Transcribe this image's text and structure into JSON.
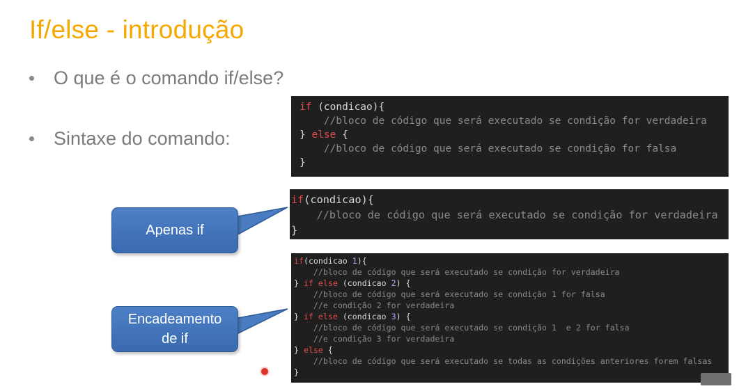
{
  "slide": {
    "title": "If/else - introdução",
    "bullets": [
      "O que é o comando if/else?",
      "Sintaxe do comando:"
    ]
  },
  "callouts": {
    "apenas_if": "Apenas if",
    "encadeamento": "Encadeamento de if"
  },
  "code_blocks": {
    "basic": [
      "if (condicao){",
      "    //bloco de código que será executado se condição for verdadeira",
      "} else {",
      "    //bloco de código que será executado se condição for falsa",
      "}"
    ],
    "only_if": [
      "if(condicao){",
      "    //bloco de código que será executado se condição for verdadeira",
      "}"
    ],
    "chain": [
      "if(condicao 1){",
      "    //bloco de código que será executado se condição for verdadeira",
      "} if else (condicao 2) {",
      "    //bloco de código que será executado se condição 1 for falsa",
      "    //e condição 2 for verdadeira",
      "} if else (condicao 3) {",
      "    //bloco de código que será executado se condição 1  e 2 for falsa",
      "    //e condição 3 for verdadeira",
      "} else {",
      "    //bloco de código que será executado se todas as condições anteriores forem falsas",
      "}"
    ]
  },
  "colors": {
    "title": "#f5a800",
    "keyword": "#e34b4b",
    "comment": "#8a8a8a",
    "callout": "#4d80c6"
  },
  "icons": {
    "pointer": "laser-pointer-icon",
    "logo": "watermark-logo-icon"
  }
}
